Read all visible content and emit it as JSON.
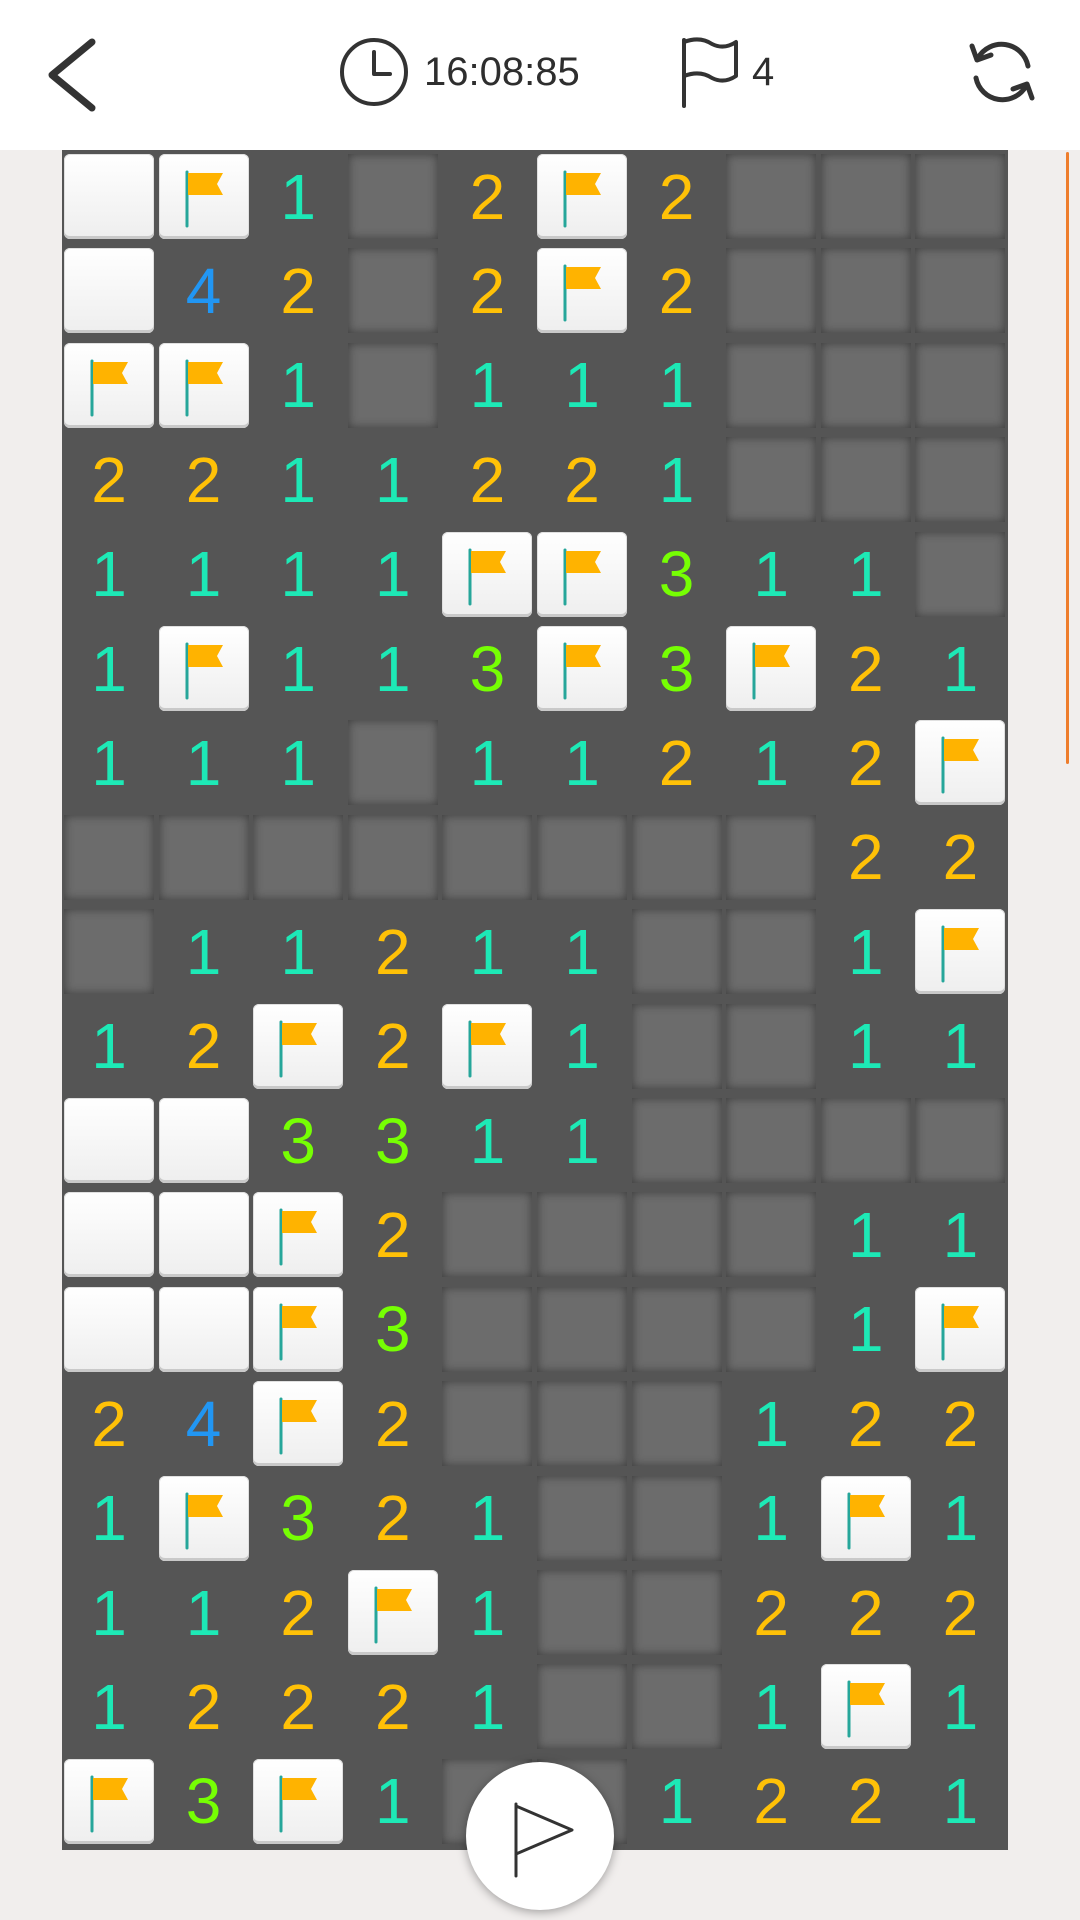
{
  "header": {
    "back_icon": "chevron-left-icon",
    "timer_icon": "clock-icon",
    "timer": "16:08:85",
    "flag_icon": "flag-outline-icon",
    "flags_count": "4",
    "restart_icon": "refresh-icon"
  },
  "board": {
    "columns": 10,
    "rows": 18,
    "legend": "F = flagged, W = revealed empty (white), . = unrevealed, digits = mine count",
    "grid": [
      "WF1.2F2...",
      "W42.2F2...",
      "FF1.111...",
      "2211221...",
      "1111FF311.",
      "1F113F3F21",
      "111.11212F",
      "........22",
      ".11211..1F",
      "12F2F1..11",
      "WW3311....",
      "WWF2....11",
      "WWF3....1F",
      "24F2...122",
      "1F321..1F1",
      "112F1..222",
      "12221..1F1",
      "F3F1..1221"
    ],
    "number_colors": {
      "1": "#1de9b6",
      "2": "#ffc107",
      "3": "#76ff03",
      "4": "#2196f3"
    },
    "flag_color": "#ffb300",
    "pole_color": "#26a69a"
  },
  "actions": {
    "mode_toggle_icon": "flag-outline-icon"
  },
  "accent_color": "#ee7d2c"
}
